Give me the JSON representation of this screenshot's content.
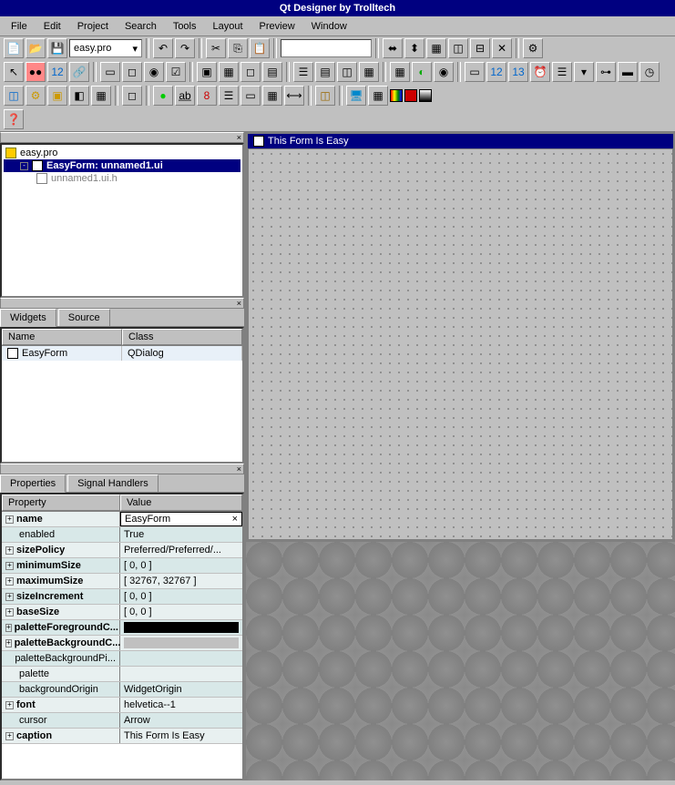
{
  "title": "Qt Designer by Trolltech",
  "menus": [
    "File",
    "Edit",
    "Project",
    "Search",
    "Tools",
    "Layout",
    "Preview",
    "Window"
  ],
  "project_file": "easy.pro",
  "tree": {
    "root": "easy.pro",
    "form": "EasyForm: unnamed1.ui",
    "child": "unnamed1.ui.h"
  },
  "widget_tabs": [
    "Widgets",
    "Source"
  ],
  "widget_table": {
    "headers": [
      "Name",
      "Class"
    ],
    "row": {
      "name": "EasyForm",
      "class": "QDialog"
    }
  },
  "props_tabs": [
    "Properties",
    "Signal Handlers"
  ],
  "props_headers": [
    "Property",
    "Value"
  ],
  "properties": [
    {
      "name": "name",
      "value": "EasyForm",
      "expand": true,
      "editing": true
    },
    {
      "name": "enabled",
      "value": "True",
      "indent": true
    },
    {
      "name": "sizePolicy",
      "value": "Preferred/Preferred/...",
      "expand": true
    },
    {
      "name": "minimumSize",
      "value": "[ 0, 0 ]",
      "expand": true
    },
    {
      "name": "maximumSize",
      "value": "[ 32767, 32767 ]",
      "expand": true
    },
    {
      "name": "sizeIncrement",
      "value": "[ 0, 0 ]",
      "expand": true
    },
    {
      "name": "baseSize",
      "value": "[ 0, 0 ]",
      "expand": true
    },
    {
      "name": "paletteForegroundC...",
      "value": "",
      "expand": true,
      "color": "#000000"
    },
    {
      "name": "paletteBackgroundC...",
      "value": "",
      "expand": true,
      "color": "#c0c0c0"
    },
    {
      "name": "paletteBackgroundPi...",
      "value": "",
      "indent": true
    },
    {
      "name": "palette",
      "value": "",
      "indent": true
    },
    {
      "name": "backgroundOrigin",
      "value": "WidgetOrigin",
      "indent": true
    },
    {
      "name": "font",
      "value": "helvetica--1",
      "expand": true
    },
    {
      "name": "cursor",
      "value": "Arrow",
      "indent": true
    },
    {
      "name": "caption",
      "value": "This Form Is Easy",
      "expand": true
    }
  ],
  "form_title": "This Form Is Easy"
}
